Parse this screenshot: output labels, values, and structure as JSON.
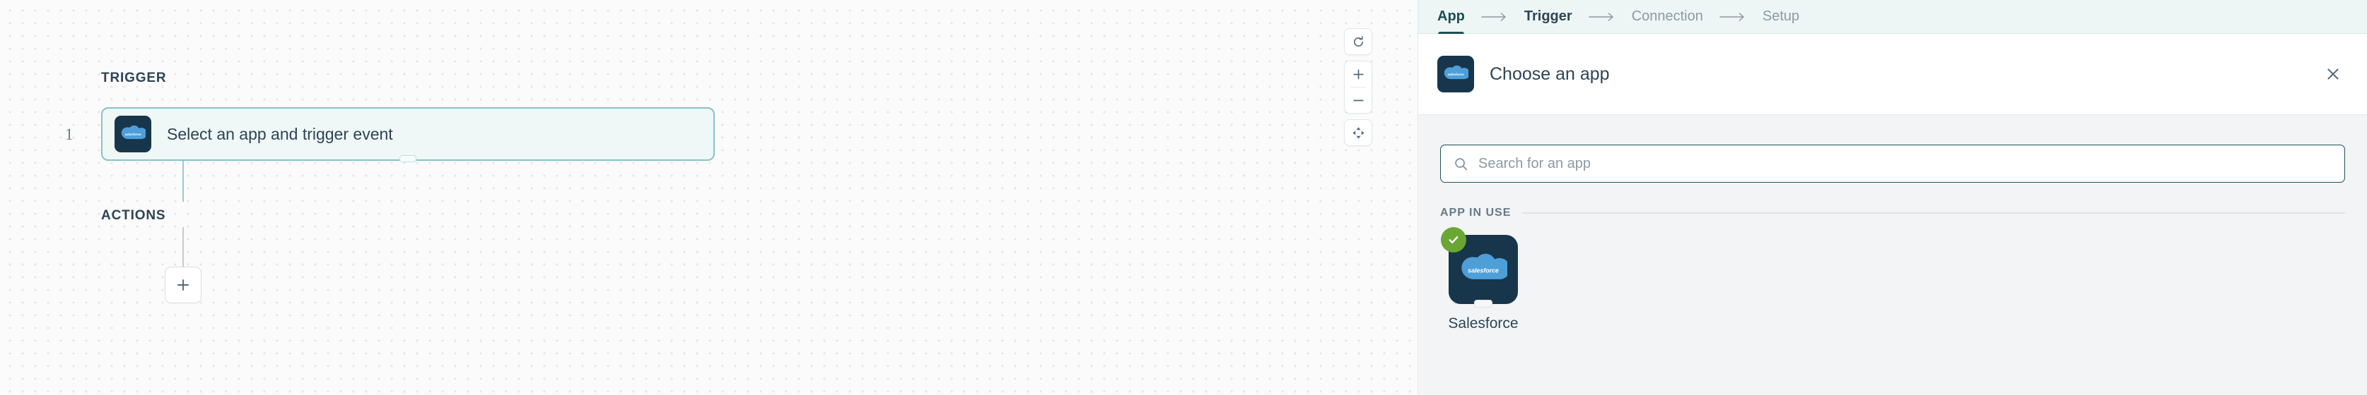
{
  "canvas": {
    "trigger_section_label": "TRIGGER",
    "actions_section_label": "ACTIONS",
    "step_number": "1",
    "trigger_card": {
      "title": "Select an app and trigger event",
      "app_icon": "salesforce-icon",
      "selected": true
    },
    "add_action_label": "+",
    "controls": [
      {
        "name": "reset-zoom-icon",
        "label": ""
      },
      {
        "name": "zoom-in-icon",
        "label": ""
      },
      {
        "name": "zoom-out-icon",
        "label": ""
      },
      {
        "name": "fit-to-screen-icon",
        "label": ""
      }
    ]
  },
  "panel": {
    "tabs": [
      {
        "label": "App",
        "state": "active"
      },
      {
        "label": "Trigger",
        "state": "done"
      },
      {
        "label": "Connection",
        "state": "pending"
      },
      {
        "label": "Setup",
        "state": "pending"
      }
    ],
    "tab_separator_icon": "arrow-right-icon",
    "header": {
      "title": "Choose an app",
      "app_icon": "salesforce-icon",
      "close_icon": "close-icon"
    },
    "search": {
      "placeholder": "Search for an app",
      "value": "",
      "icon": "search-icon"
    },
    "app_in_use": {
      "heading": "APP IN USE",
      "apps": [
        {
          "label": "Salesforce",
          "icon": "salesforce-icon",
          "selected": true,
          "badge_icon": "check-icon"
        }
      ]
    }
  },
  "colors": {
    "accent_teal": "#1b4e52",
    "card_border": "#87c4c6",
    "card_fill": "#eff7f7",
    "panel_bg": "#f2f4f5",
    "tabbar_bg": "#eef5f5",
    "salesforce_navy": "#17364b",
    "salesforce_blue": "#4e9fd8",
    "check_green": "#6aa634",
    "text_dark": "#2e4456",
    "text_muted": "#8c9aa3"
  }
}
